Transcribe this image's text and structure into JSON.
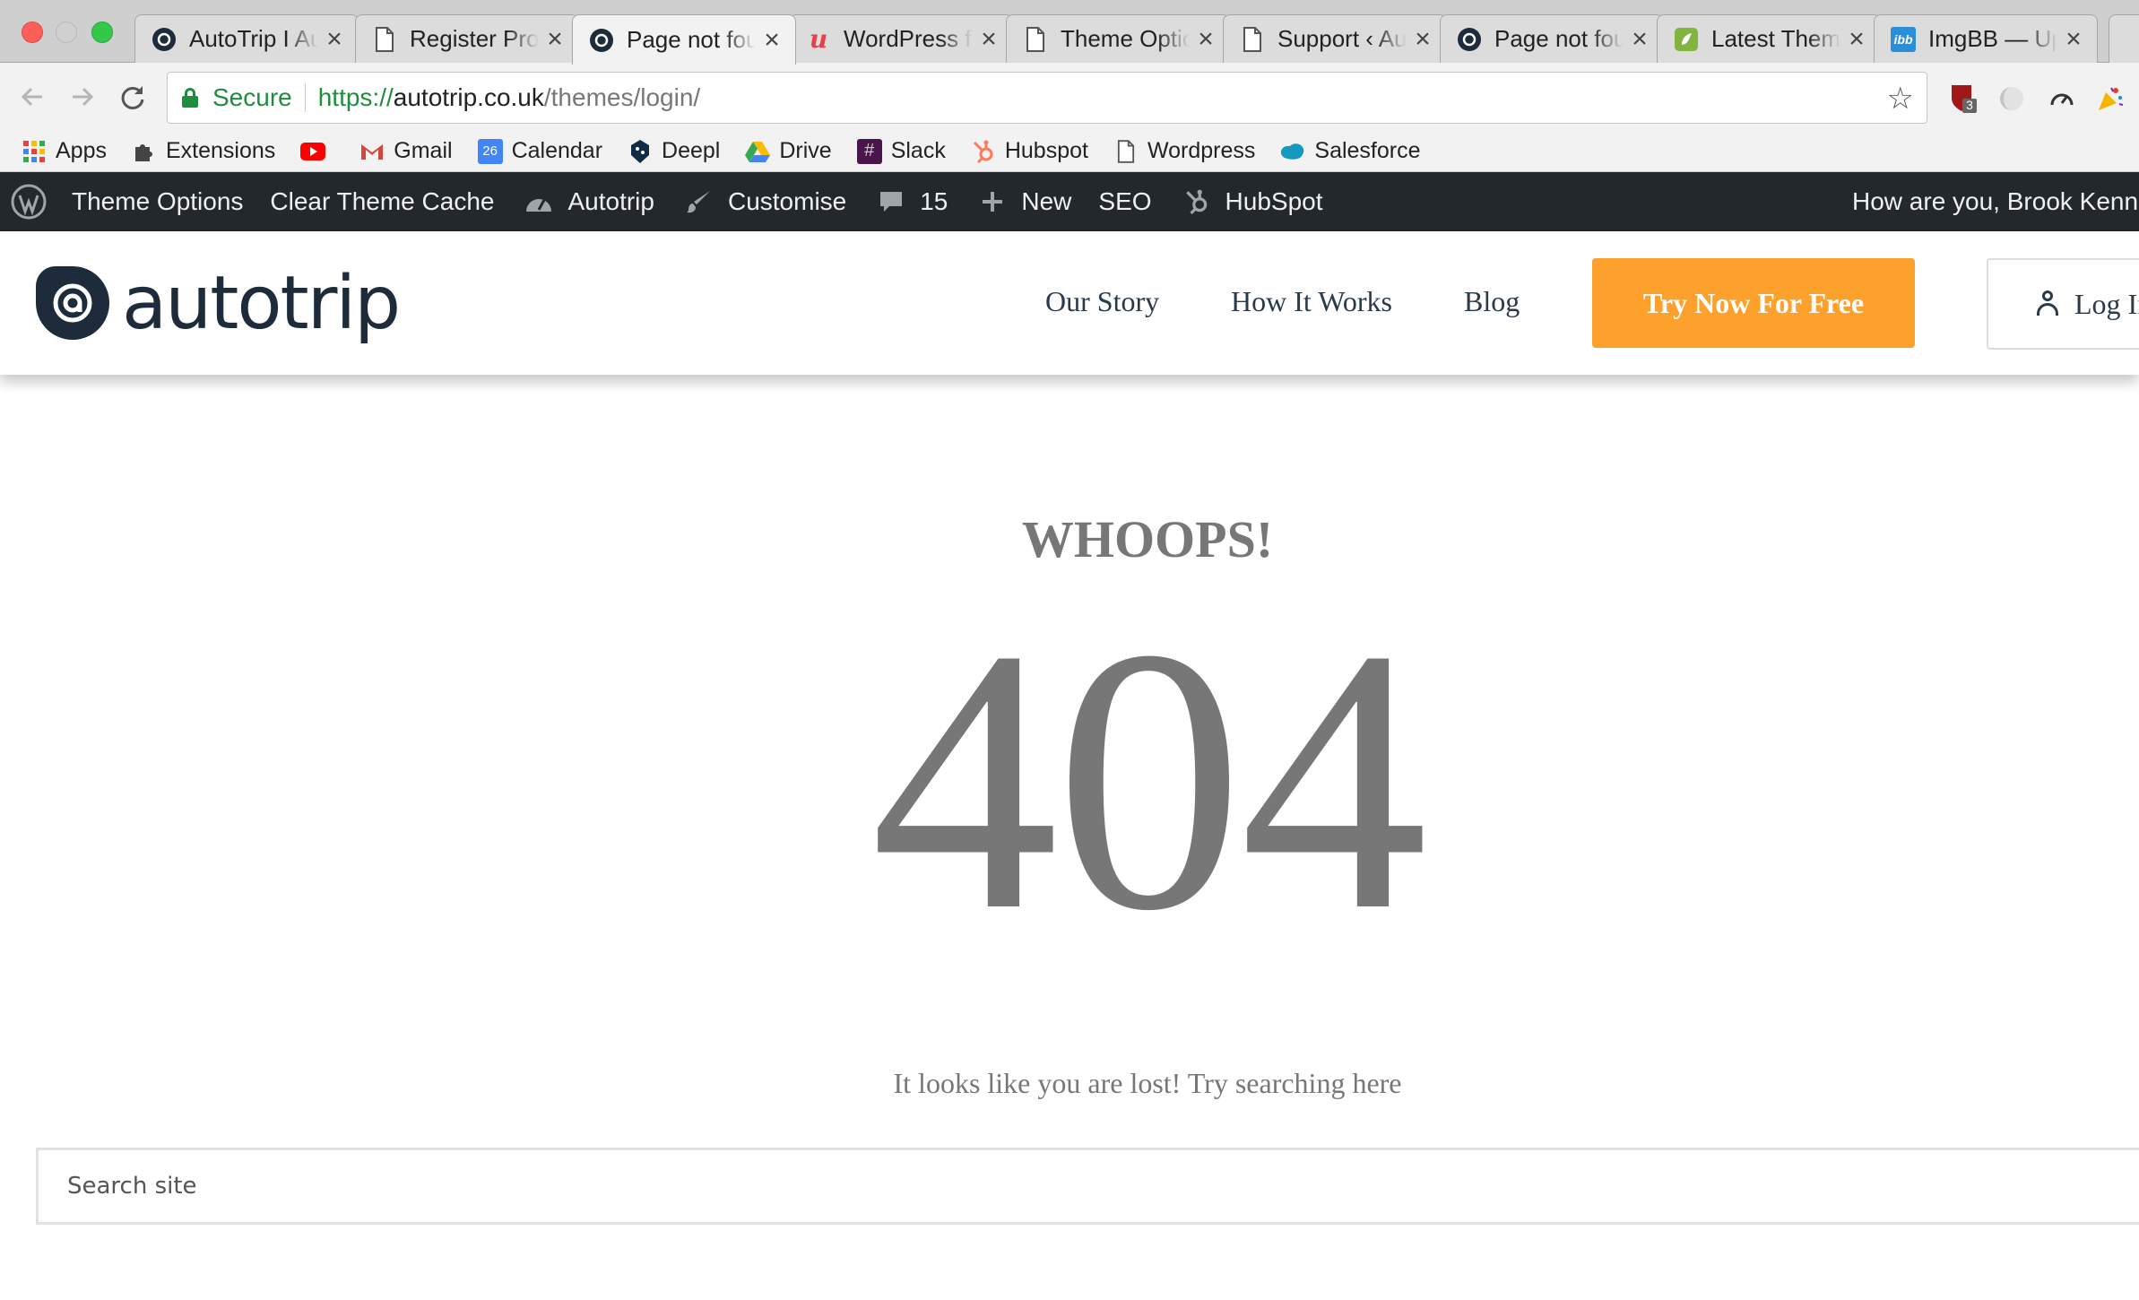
{
  "browser": {
    "tabs": [
      {
        "title": "AutoTrip I Automat",
        "favicon": "autotrip-favicon",
        "active": false
      },
      {
        "title": "Register Profile",
        "favicon": "page-icon",
        "active": false
      },
      {
        "title": "Page not found",
        "favicon": "autotrip-favicon",
        "active": true
      },
      {
        "title": "WordPress feedback",
        "favicon": "unbounce-icon",
        "active": false
      },
      {
        "title": "Theme Options",
        "favicon": "page-icon",
        "active": false
      },
      {
        "title": "Support ‹ AutoTrip",
        "favicon": "page-icon",
        "active": false
      },
      {
        "title": "Page not found",
        "favicon": "autotrip-favicon",
        "active": false
      },
      {
        "title": "Latest Themes",
        "favicon": "envato-icon",
        "active": false
      },
      {
        "title": "ImgBB — Upload",
        "favicon": "imgbb-icon",
        "active": false
      }
    ],
    "tab_close_glyph": "×",
    "omnibox": {
      "secure_label": "Secure",
      "url_scheme": "https://",
      "url_host": "autotrip.co.uk",
      "url_path": "/themes/login/"
    },
    "extension_badge": "3",
    "bookmarks": [
      {
        "label": "Apps",
        "icon": "apps-grid-icon"
      },
      {
        "label": "Extensions",
        "icon": "puzzle-icon"
      },
      {
        "label": "",
        "icon": "youtube-icon"
      },
      {
        "label": "Gmail",
        "icon": "gmail-icon"
      },
      {
        "label": "Calendar",
        "icon": "calendar-icon",
        "icon_text": "26"
      },
      {
        "label": "Deepl",
        "icon": "deepl-icon"
      },
      {
        "label": "Drive",
        "icon": "drive-icon"
      },
      {
        "label": "Slack",
        "icon": "slack-icon"
      },
      {
        "label": "Hubspot",
        "icon": "hubspot-icon"
      },
      {
        "label": "Wordpress",
        "icon": "page-icon"
      },
      {
        "label": "Salesforce",
        "icon": "salesforce-icon"
      }
    ]
  },
  "adminbar": {
    "theme_options": "Theme Options",
    "clear_cache": "Clear Theme Cache",
    "site_name": "Autotrip",
    "customise": "Customise",
    "comments_count": "15",
    "new": "New",
    "seo": "SEO",
    "hubspot": "HubSpot",
    "greeting": "How are you, Brook Kennedy"
  },
  "site": {
    "logo_text": "autotrip",
    "nav": [
      "Our Story",
      "How It Works",
      "Blog"
    ],
    "cta_label": "Try Now For Free",
    "login_label": "Log In",
    "colors": {
      "brand_dark": "#1e2b3a",
      "cta_orange": "#fba12c",
      "text_grey": "#777777"
    }
  },
  "error_page": {
    "heading": "WHOOPS!",
    "code": "404",
    "message": "It looks like you are lost! Try searching here",
    "search_placeholder": "Search site"
  }
}
